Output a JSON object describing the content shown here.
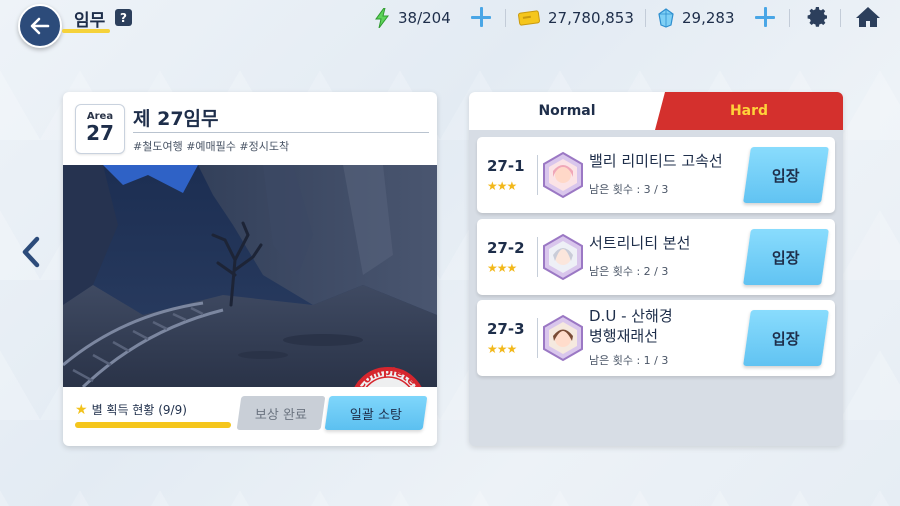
{
  "header": {
    "title": "임무",
    "help_label": "?"
  },
  "resources": {
    "stamina": "38/204",
    "credits": "27,780,853",
    "gems": "29,283"
  },
  "mission": {
    "area_label": "Area",
    "area_number": "27",
    "title": "제 27임무",
    "tags": "#철도여행 #예매필수 #정시도착",
    "stamp_text": "Complete!",
    "star_progress_label": "별 획득 현황 (9/9)",
    "star_progress_value": 1.0,
    "reward_button": "보상 완료",
    "sweep_button": "일괄 소탕"
  },
  "tabs": {
    "normal": "Normal",
    "hard": "Hard",
    "selected": "Hard"
  },
  "stages": [
    {
      "number": "27-1",
      "stars": "★★★",
      "name_line1": "밸리 리미티드 고속선",
      "name_line2": "",
      "remaining": "남은 횟수 : 3 / 3",
      "enter": "입장"
    },
    {
      "number": "27-2",
      "stars": "★★★",
      "name_line1": "서트리니티 본선",
      "name_line2": "",
      "remaining": "남은 횟수 : 2 / 3",
      "enter": "입장"
    },
    {
      "number": "27-3",
      "stars": "★★★",
      "name_line1": "D.U - 산해경",
      "name_line2": "병행재래선",
      "remaining": "남은 횟수 : 1 / 3",
      "enter": "입장"
    }
  ],
  "colors": {
    "accent_blue": "#5cc0f0",
    "hard_red": "#d4302d",
    "hard_text": "#ffd23a",
    "star_yellow": "#f5c61c",
    "dark_navy": "#2c4b7a"
  },
  "icons": [
    "back-arrow-icon",
    "help-icon",
    "stamina-bolt-icon",
    "credit-icon",
    "gem-icon",
    "plus-icon",
    "gear-icon",
    "home-icon",
    "left-arrow-icon",
    "star-icon"
  ]
}
